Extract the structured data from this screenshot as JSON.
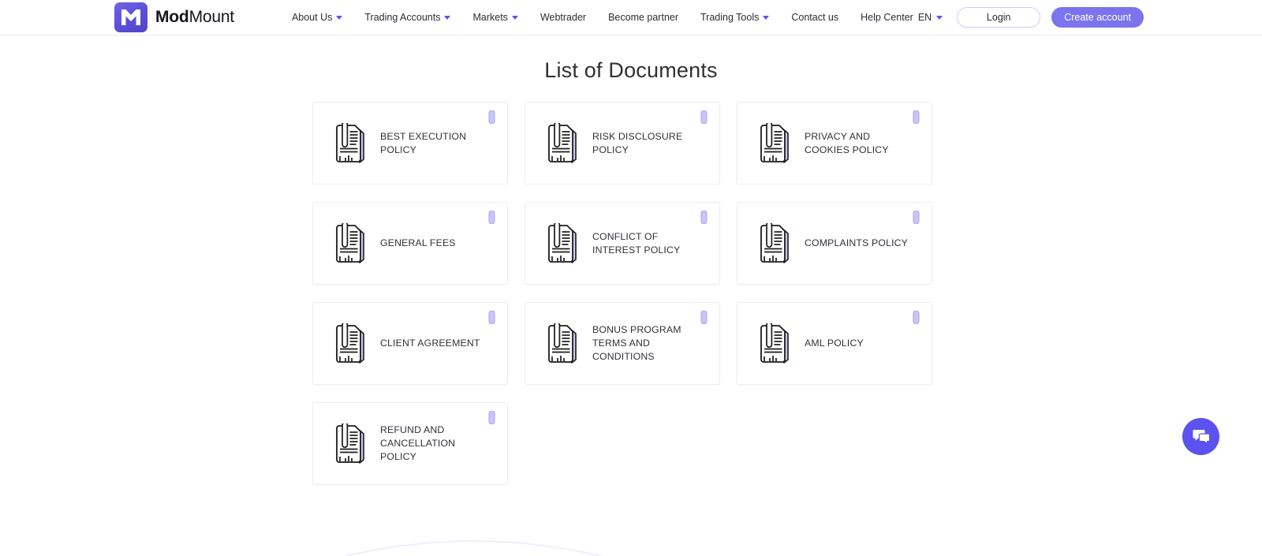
{
  "header": {
    "brand": {
      "bold": "Mod",
      "light": "Mount",
      "logo_icon": "modmount-m-logo",
      "brand_color": "#5b52f0"
    },
    "nav": [
      {
        "label": "About Us",
        "has_caret": true
      },
      {
        "label": "Trading Accounts",
        "has_caret": true
      },
      {
        "label": "Markets",
        "has_caret": true
      },
      {
        "label": "Webtrader",
        "has_caret": false
      },
      {
        "label": "Become partner",
        "has_caret": false
      },
      {
        "label": "Trading Tools",
        "has_caret": true
      },
      {
        "label": "Contact us",
        "has_caret": false
      },
      {
        "label": "Help Center",
        "has_caret": false
      }
    ],
    "language": {
      "label": "EN",
      "has_caret": true
    },
    "login_label": "Login",
    "create_account_label": "Create account"
  },
  "main": {
    "title": "List of Documents",
    "documents": [
      {
        "label": "BEST EXECUTION POLICY",
        "icon": "document-paperclip-icon",
        "download_icon": "paperclip-icon"
      },
      {
        "label": "RISK DISCLOSURE POLICY",
        "icon": "document-paperclip-icon",
        "download_icon": "paperclip-icon"
      },
      {
        "label": "PRIVACY AND COOKIES POLICY",
        "icon": "document-paperclip-icon",
        "download_icon": "paperclip-icon"
      },
      {
        "label": "GENERAL FEES",
        "icon": "document-paperclip-icon",
        "download_icon": "paperclip-icon"
      },
      {
        "label": "CONFLICT OF INTEREST POLICY",
        "icon": "document-paperclip-icon",
        "download_icon": "paperclip-icon"
      },
      {
        "label": "COMPLAINTS POLICY",
        "icon": "document-paperclip-icon",
        "download_icon": "paperclip-icon"
      },
      {
        "label": "CLIENT AGREEMENT",
        "icon": "document-paperclip-icon",
        "download_icon": "paperclip-icon"
      },
      {
        "label": "BONUS PROGRAM TERMS AND CONDITIONS",
        "icon": "document-paperclip-icon",
        "download_icon": "paperclip-icon"
      },
      {
        "label": "AML POLICY",
        "icon": "document-paperclip-icon",
        "download_icon": "paperclip-icon"
      },
      {
        "label": "REFUND AND CANCELLATION POLICY",
        "icon": "document-paperclip-icon",
        "download_icon": "paperclip-icon"
      }
    ]
  },
  "widgets": {
    "chat": {
      "icon": "chat-bubbles-icon",
      "color": "#5b52f0"
    }
  },
  "colors": {
    "accent": "#5b52f0",
    "accent_soft": "#7b74ee",
    "clip_light": "#b9b4f5",
    "text": "#31323a",
    "border": "#ececed"
  }
}
